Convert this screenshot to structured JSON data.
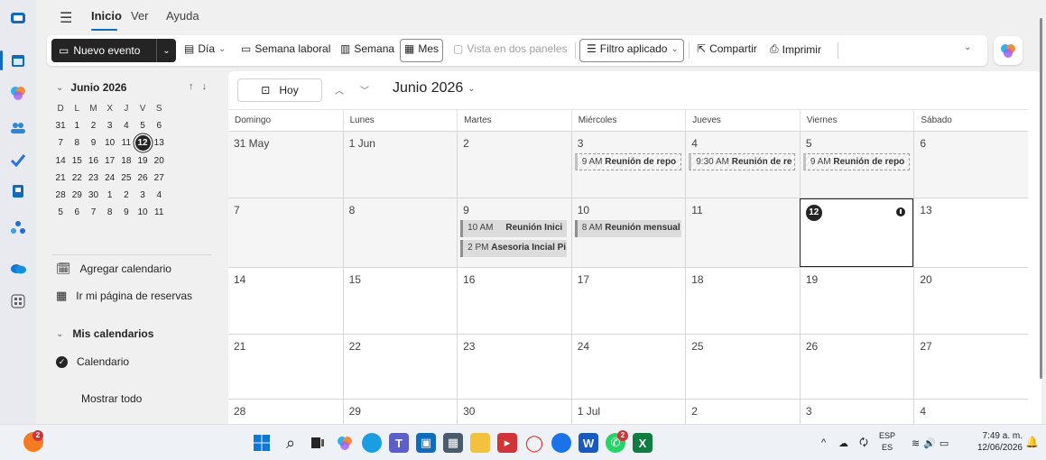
{
  "menu": {
    "items": [
      "Inicio",
      "Ver",
      "Ayuda"
    ],
    "active": "Inicio"
  },
  "ribbon": {
    "new_event": "Nuevo evento",
    "day": "Día",
    "work_week": "Semana laboral",
    "week": "Semana",
    "month": "Mes",
    "split_view": "Vista en dos paneles",
    "filter": "Filtro aplicado",
    "share": "Compartir",
    "print": "Imprimir"
  },
  "mini_calendar": {
    "title": "Junio 2026",
    "dow": [
      "D",
      "L",
      "M",
      "X",
      "J",
      "V",
      "S"
    ],
    "weeks": [
      [
        "31",
        "1",
        "2",
        "3",
        "4",
        "5",
        "6"
      ],
      [
        "7",
        "8",
        "9",
        "10",
        "11",
        "12",
        "13"
      ],
      [
        "14",
        "15",
        "16",
        "17",
        "18",
        "19",
        "20"
      ],
      [
        "21",
        "22",
        "23",
        "24",
        "25",
        "26",
        "27"
      ],
      [
        "28",
        "29",
        "30",
        "1",
        "2",
        "3",
        "4"
      ],
      [
        "5",
        "6",
        "7",
        "8",
        "9",
        "10",
        "11"
      ]
    ],
    "today": "12"
  },
  "left_pane": {
    "add_calendar": "Agregar calendario",
    "booking": "Ir mi página de reservas",
    "my_calendars": "Mis calendarios",
    "calendar": "Calendario",
    "show_all": "Mostrar todo"
  },
  "main": {
    "today_btn": "Hoy",
    "month_title": "Junio 2026",
    "dow": [
      "Domingo",
      "Lunes",
      "Martes",
      "Miércoles",
      "Jueves",
      "Viernes",
      "Sábado"
    ],
    "weeks": [
      {
        "days": [
          "31 May",
          "1 Jun",
          "2",
          "3",
          "4",
          "5",
          "6"
        ]
      },
      {
        "days": [
          "7",
          "8",
          "9",
          "10",
          "11",
          "12",
          "13"
        ]
      },
      {
        "days": [
          "14",
          "15",
          "16",
          "17",
          "18",
          "19",
          "20"
        ]
      },
      {
        "days": [
          "21",
          "22",
          "23",
          "24",
          "25",
          "26",
          "27"
        ]
      },
      {
        "days": [
          "28",
          "29",
          "30",
          "1 Jul",
          "2",
          "3",
          "4"
        ]
      }
    ],
    "events": {
      "w0_wed": {
        "time": "9 AM",
        "title": "Reunión de repo"
      },
      "w0_thu": {
        "time": "9:30 AM",
        "title": "Reunión de re"
      },
      "w0_fri": {
        "time": "9 AM",
        "title": "Reunión de repo"
      },
      "w1_tue_1": {
        "time": "10 AM",
        "title": "Reunión Inici"
      },
      "w1_tue_2": {
        "time": "2 PM",
        "title": "Asesoria Incial Pi"
      },
      "w1_wed": {
        "time": "8 AM",
        "title": "Reunión mensual"
      }
    }
  },
  "taskbar": {
    "lang_top": "ESP",
    "lang_bottom": "ES",
    "time": "7:49 a. m.",
    "date": "12/06/2026",
    "badge_count": "2"
  },
  "colors": {
    "accent": "#0f6cbd",
    "dark": "#242424"
  }
}
